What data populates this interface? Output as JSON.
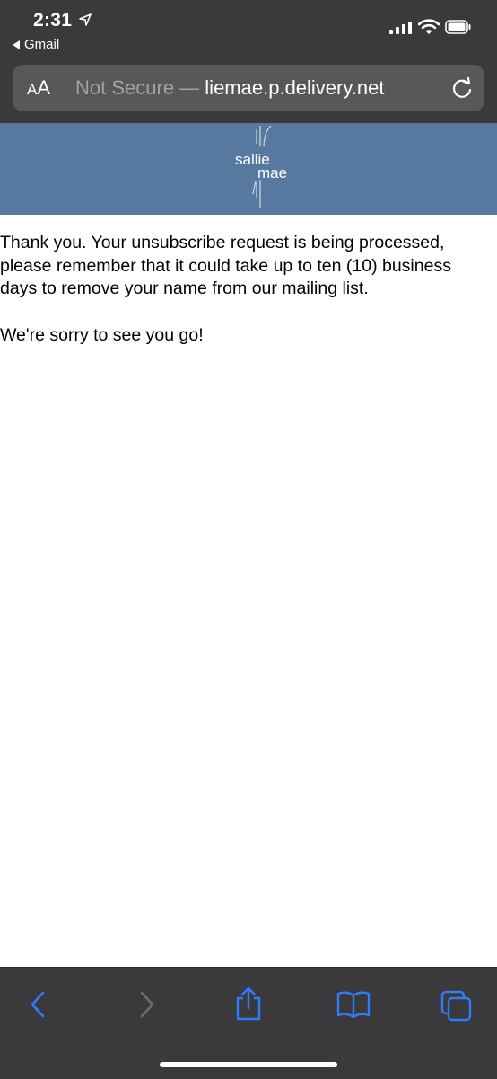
{
  "status_bar": {
    "time": "2:31",
    "back_app": "Gmail"
  },
  "address_bar": {
    "text_size_label_small": "A",
    "text_size_label_large": "A",
    "security_label": "Not Secure",
    "separator": " — ",
    "host_truncated": "liemae.p.delivery.net"
  },
  "banner": {
    "logo_line1": "sallie",
    "logo_line2": "mae",
    "colors": {
      "banner_bg": "#58799f",
      "chrome_bg": "#3a3a3c"
    }
  },
  "content": {
    "message": "Thank you. Your unsubscribe request is being processed, please remember that it could take up to ten (10) business days to remove your name from our mailing list.",
    "farewell": "We're sorry to see you go!"
  },
  "toolbar": {
    "icons": [
      "back-icon",
      "forward-icon",
      "share-icon",
      "bookmarks-icon",
      "tabs-icon"
    ],
    "accent": "#2f7cf6"
  }
}
